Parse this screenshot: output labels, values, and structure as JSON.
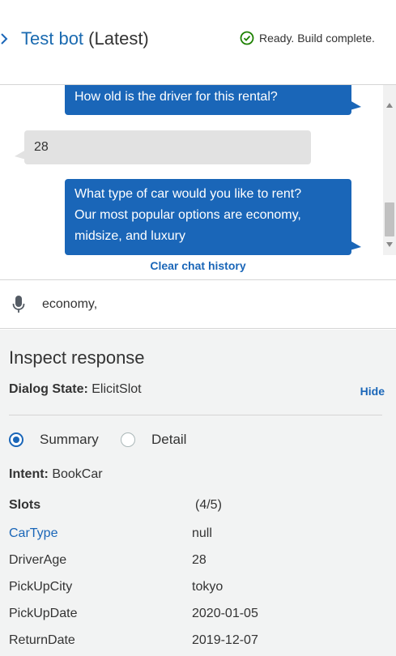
{
  "header": {
    "bot_name": "Test bot",
    "version": "(Latest)",
    "status": "Ready. Build complete.",
    "status_color": "#1d8102"
  },
  "chat": {
    "messages": [
      {
        "from": "bot",
        "text": "How old is the driver for this rental?"
      },
      {
        "from": "user",
        "text": "28"
      },
      {
        "from": "bot",
        "lines": [
          "What type of car would you like to rent?",
          "Our most popular options are economy,",
          "midsize, and luxury"
        ]
      }
    ],
    "clear_label": "Clear chat history"
  },
  "input": {
    "value": "economy,",
    "mic_icon": "microphone-icon"
  },
  "inspect": {
    "title": "Inspect response",
    "dialog_state_label": "Dialog State:",
    "dialog_state_value": "ElicitSlot",
    "hide_label": "Hide",
    "views": [
      {
        "label": "Summary",
        "selected": true
      },
      {
        "label": "Detail",
        "selected": false
      }
    ],
    "intent_label": "Intent:",
    "intent_value": "BookCar",
    "slots_label": "Slots",
    "slots_count": "(4/5)",
    "slots": [
      {
        "name": "CarType",
        "value": "null"
      },
      {
        "name": "DriverAge",
        "value": "28"
      },
      {
        "name": "PickUpCity",
        "value": "tokyo"
      },
      {
        "name": "PickUpDate",
        "value": "2020-01-05"
      },
      {
        "name": "ReturnDate",
        "value": "2019-12-07"
      }
    ]
  },
  "colors": {
    "accent": "#1a66b8",
    "user_bubble": "#e2e2e2",
    "panel_bg": "#f2f3f3"
  }
}
